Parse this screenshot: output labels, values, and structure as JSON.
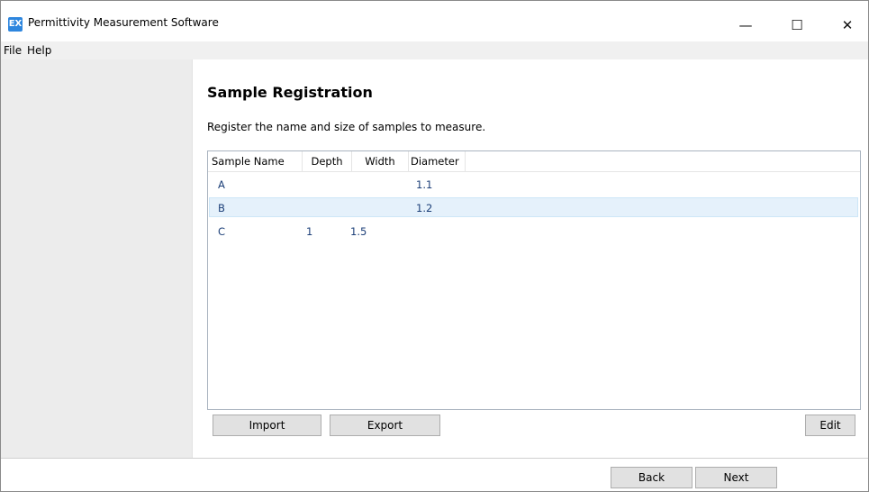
{
  "window": {
    "title": "Permittivity Measurement Software",
    "icon_text": "EX",
    "minimize": "—",
    "maximize": "☐",
    "close": "✕"
  },
  "menu": {
    "items": [
      "File",
      "Help"
    ]
  },
  "page": {
    "title": "Sample Registration",
    "description": "Register the name and size of samples to measure."
  },
  "table": {
    "columns": [
      "Sample Name",
      "Depth",
      "Width",
      "Diameter"
    ],
    "rows": [
      {
        "name": "A",
        "depth": "",
        "width": "",
        "diameter": "1.1"
      },
      {
        "name": "B",
        "depth": "",
        "width": "",
        "diameter": "1.2"
      },
      {
        "name": "C",
        "depth": "1",
        "width": "1.5",
        "diameter": ""
      }
    ],
    "selected_row": "B"
  },
  "actions": {
    "import": "Import",
    "export": "Export",
    "edit": "Edit"
  },
  "nav": {
    "back": "Back",
    "next": "Next"
  }
}
